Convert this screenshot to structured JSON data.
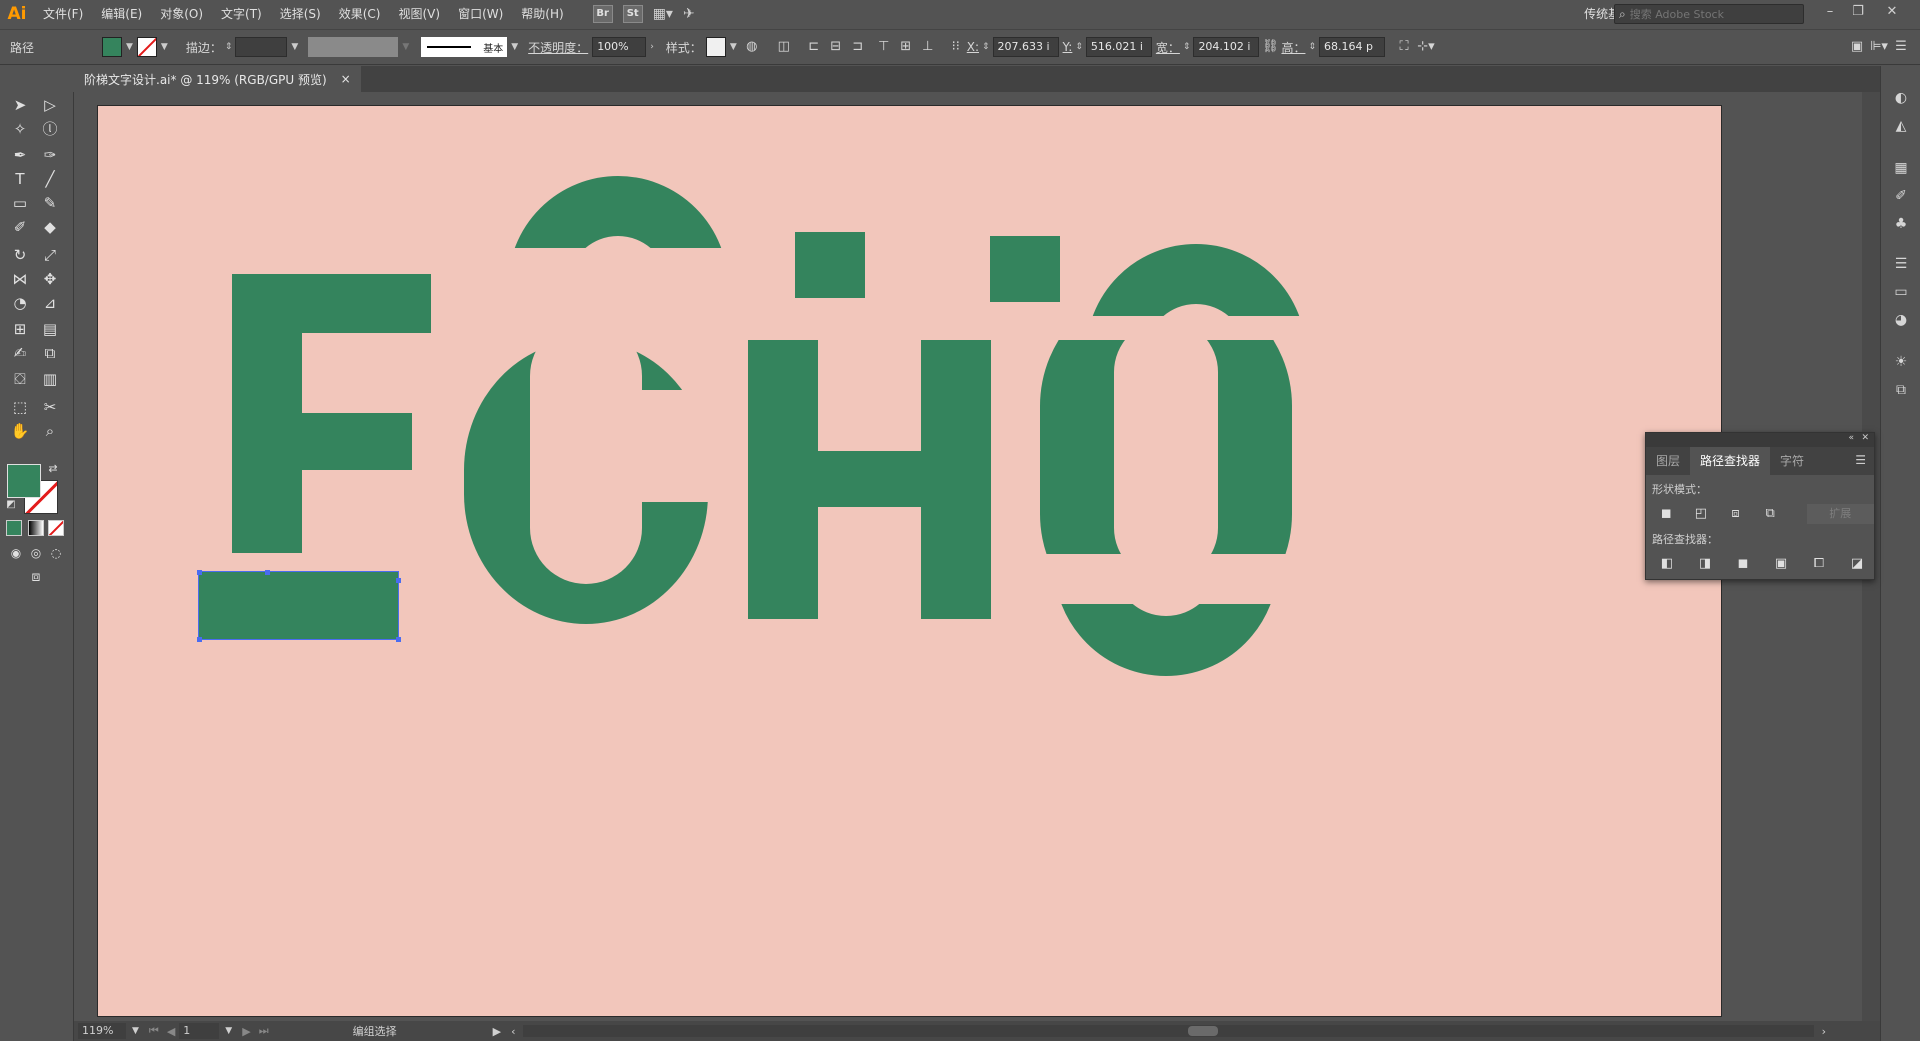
{
  "app": {
    "logo": "Ai"
  },
  "menu": [
    "文件(F)",
    "编辑(E)",
    "对象(O)",
    "文字(T)",
    "选择(S)",
    "效果(C)",
    "视图(V)",
    "窗口(W)",
    "帮助(H)"
  ],
  "menu_icons": {
    "bridge": "Br",
    "stock": "St"
  },
  "workspace": "传统基本功能",
  "search": {
    "placeholder": "搜索 Adobe Stock"
  },
  "control": {
    "selection_label": "路径",
    "stroke_label": "描边：",
    "stroke_style": "基本",
    "opacity_label": "不透明度：",
    "opacity_value": "100%",
    "style_label": "样式：",
    "x_label": "X:",
    "x_value": "207.633 i",
    "y_label": "Y:",
    "y_value": "516.021 i",
    "w_label": "宽：",
    "w_value": "204.102 i",
    "h_label": "高：",
    "h_value": "68.164 p",
    "fill_color": "#35845d"
  },
  "document_tab": {
    "title": "阶梯文字设计.ai* @ 119% (RGB/GPU 预览)",
    "close": "×"
  },
  "artboard": {
    "background": "#f2c6bb",
    "letter_color": "#34845d",
    "selection_color": "#4a6cf0"
  },
  "panel": {
    "tabs": [
      "图层",
      "路径查找器",
      "字符"
    ],
    "active_tab": "路径查找器",
    "shape_modes_label": "形状模式：",
    "expand_label": "扩展",
    "pathfinders_label": "路径查找器："
  },
  "status": {
    "zoom": "119%",
    "page": "1",
    "tool": "编组选择"
  }
}
